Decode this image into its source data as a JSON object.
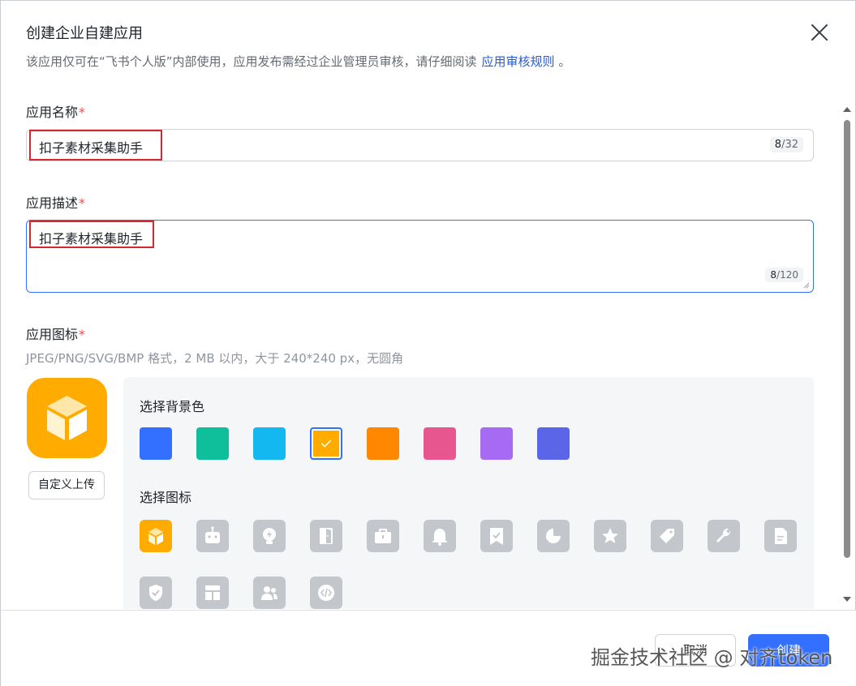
{
  "dialog": {
    "title": "创建企业自建应用",
    "subtitle": "该应用仅可在“飞书个人版”内部使用，应用发布需经过企业管理员审核，请仔细阅读",
    "subtitle_link": "应用审核规则",
    "subtitle_end": "。"
  },
  "name_field": {
    "label": "应用名称",
    "required_mark": "*",
    "value": "扣子素材采集助手",
    "count": "8",
    "max": "/32"
  },
  "desc_field": {
    "label": "应用描述",
    "required_mark": "*",
    "value": "扣子素材采集助手",
    "count": "8",
    "max": "/120"
  },
  "icon_field": {
    "label": "应用图标",
    "required_mark": "*",
    "hint": "JPEG/PNG/SVG/BMP 格式，2 MB 以内，大于 240*240 px，无圆角",
    "upload_label": "自定义上传"
  },
  "picker": {
    "bg_title": "选择背景色",
    "icon_title": "选择图标",
    "colors": [
      "#3370ff",
      "#0fbf9c",
      "#14b8f0",
      "#ffab00",
      "#ff8800",
      "#e8568f",
      "#a66bf2",
      "#5b65e8"
    ],
    "selected_color_index": 3,
    "icons": [
      "box-icon",
      "robot-icon",
      "bulb-icon",
      "door-icon",
      "briefcase-icon",
      "bell-icon",
      "bookmark-check-icon",
      "pie-icon",
      "star-icon",
      "tag-icon",
      "wrench-icon",
      "document-icon",
      "shield-check-icon",
      "layout-icon",
      "users-icon",
      "code-icon"
    ],
    "selected_icon_index": 0
  },
  "footer": {
    "cancel_label": "取消",
    "create_label": "创建"
  },
  "watermark": "掘金技术社区 @ 对齐token"
}
